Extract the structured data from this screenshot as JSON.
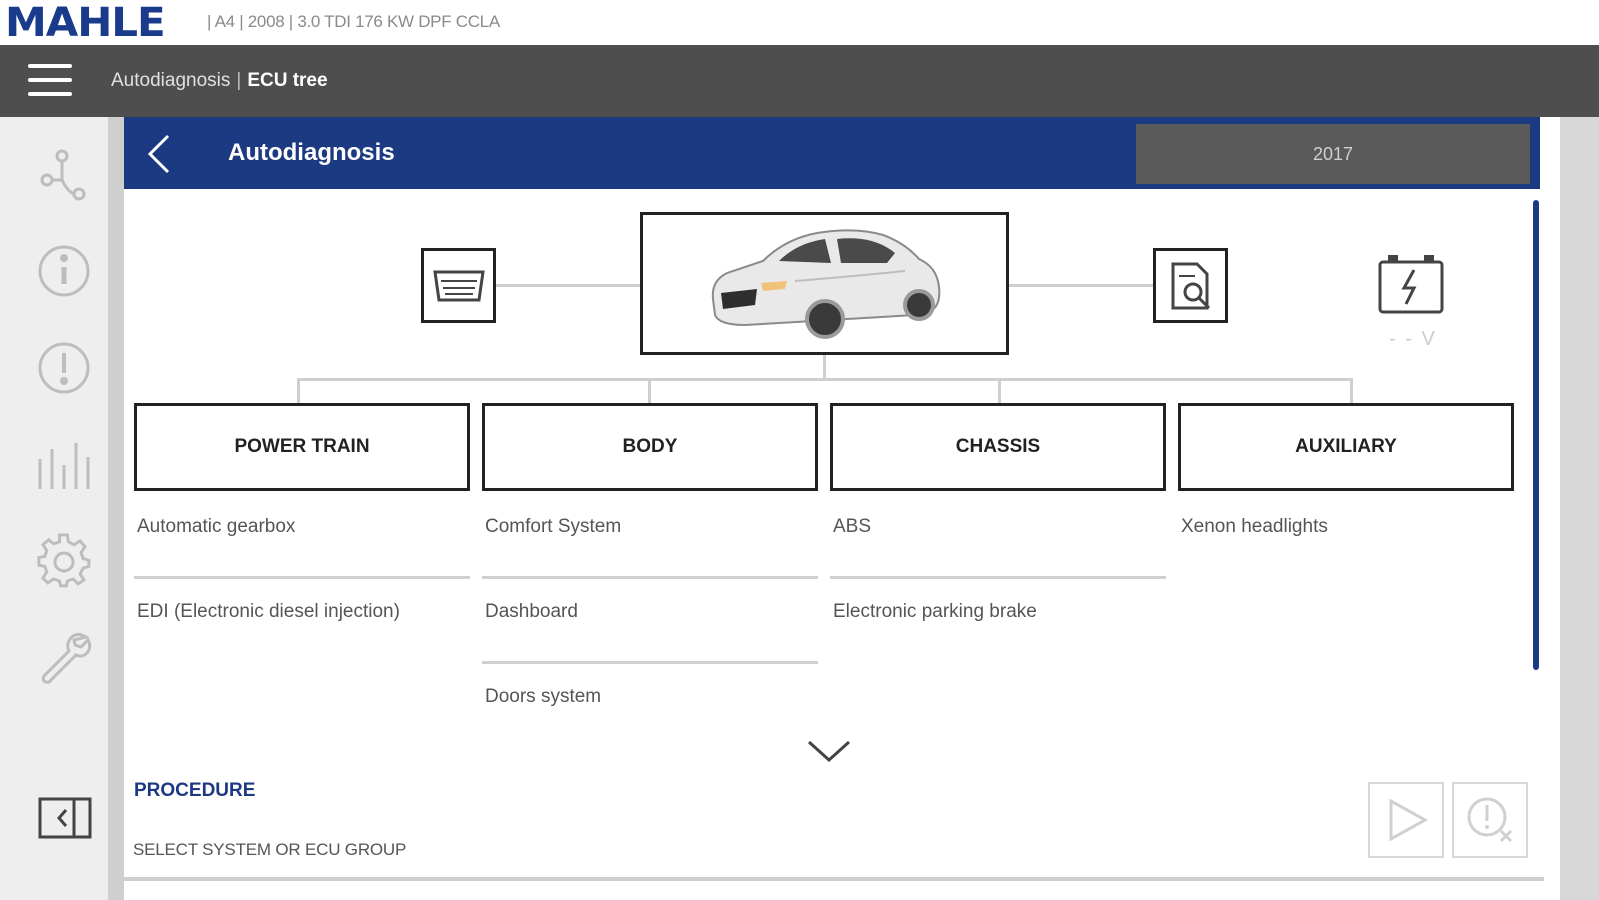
{
  "brand": {
    "logo_text": "MAHLE",
    "vehicle_info": "| A4 | 2008 | 3.0 TDI 176 KW DPF CCLA"
  },
  "header": {
    "breadcrumb_parent": "Autodiagnosis",
    "breadcrumb_separator": "|",
    "breadcrumb_current": "ECU tree"
  },
  "sidebar": {
    "items": [
      {
        "icon": "topology-icon"
      },
      {
        "icon": "info-icon"
      },
      {
        "icon": "warning-icon"
      },
      {
        "icon": "chart-icon"
      },
      {
        "icon": "gear-icon"
      },
      {
        "icon": "wrench-icon"
      }
    ],
    "toggle_icon": "collapse-sidebar-icon"
  },
  "panel": {
    "title": "Autodiagnosis",
    "year": "2017"
  },
  "diagram": {
    "battery_voltage": "- - V",
    "groups": [
      {
        "label": "POWER TRAIN",
        "items": [
          "Automatic gearbox",
          "EDI (Electronic diesel injection)"
        ]
      },
      {
        "label": "BODY",
        "items": [
          "Comfort System",
          "Dashboard",
          "Doors system"
        ]
      },
      {
        "label": "CHASSIS",
        "items": [
          "ABS",
          "Electronic parking brake"
        ]
      },
      {
        "label": "AUXILIARY",
        "items": [
          "Xenon headlights"
        ]
      }
    ]
  },
  "procedure": {
    "label": "PROCEDURE",
    "text": "SELECT SYSTEM OR ECU GROUP"
  },
  "colors": {
    "brand_blue": "#1c3a82",
    "header_grey": "#4e4e4e",
    "sidebar_grey": "#eeeeee"
  }
}
